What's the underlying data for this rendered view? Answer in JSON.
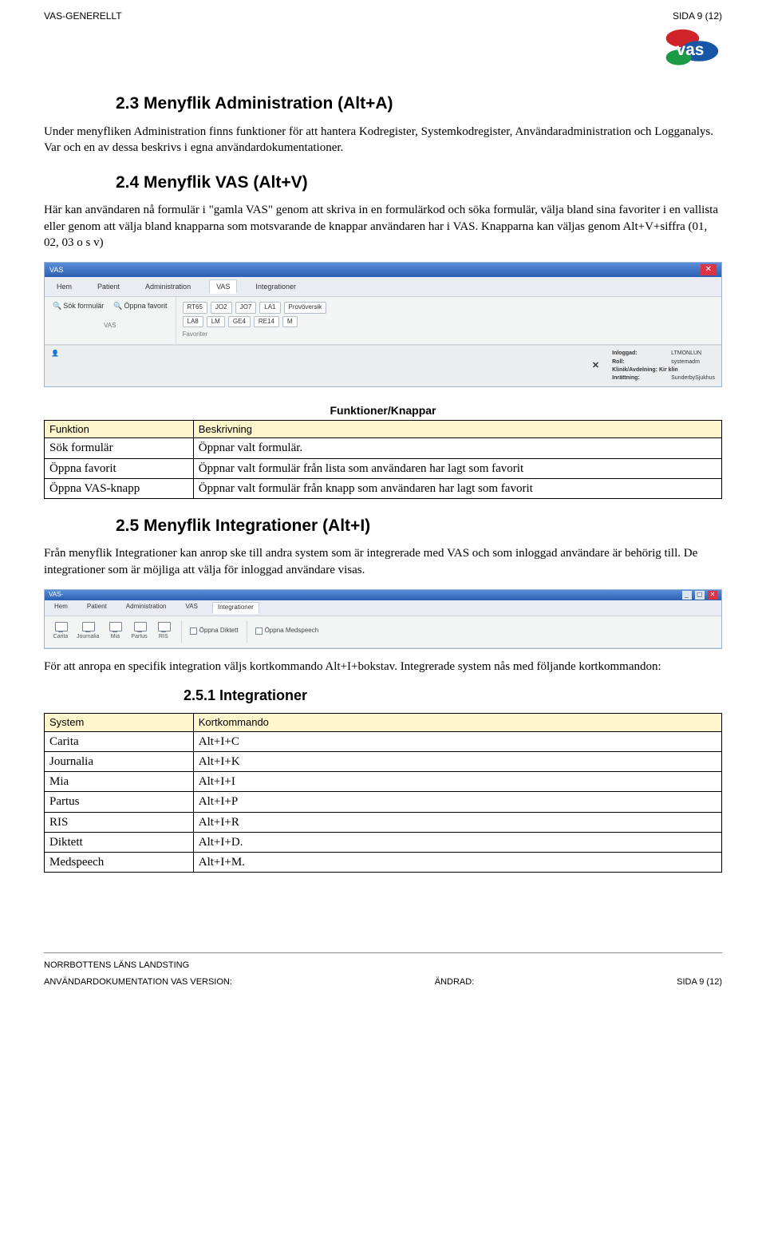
{
  "header": {
    "left": "VAS-GENERELLT",
    "right": "SIDA 9 (12)"
  },
  "logo_title": "VAS",
  "section_23": {
    "title": "2.3 Menyflik Administration (Alt+A)",
    "body": "Under menyfliken Administration finns funktioner för att hantera Kodregister, Systemkodregister, Användaradministration och Logganalys. Var och en av dessa beskrivs i egna användardokumentationer."
  },
  "section_24": {
    "title": "2.4 Menyflik VAS (Alt+V)",
    "body": "Här kan användaren nå formulär i \"gamla VAS\" genom att skriva in en formulärkod och söka formulär, välja bland sina favoriter i en vallista eller genom att välja bland knapparna som motsvarande de knappar användaren har i VAS. Knapparna kan väljas genom Alt+V+siffra (01, 02, 03 o s v)"
  },
  "shot1": {
    "window_title": "VAS",
    "menu": [
      "Hem",
      "Patient",
      "Administration",
      "VAS",
      "Integrationer"
    ],
    "active_menu_index": 3,
    "left_buttons": [
      "Sök formulär",
      "Öppna favorit"
    ],
    "left_group_label": "VAS",
    "fav_rows": [
      [
        "RT65",
        "JO2",
        "JO7",
        "LA1",
        "Provöversik"
      ],
      [
        "LA8",
        "LM",
        "GE4",
        "RE14",
        "M"
      ]
    ],
    "fav_group_label": "Favoriter",
    "status": {
      "inloggad": "LTMONLUN",
      "roll": "systemadm",
      "klinik": "Klinik/Avdelning: Kir klin",
      "inrattning": "SunderbySjukhus",
      "inrattning_label": "Inrättning:"
    }
  },
  "table1_caption": "Funktioner/Knappar",
  "table1": {
    "headers": [
      "Funktion",
      "Beskrivning"
    ],
    "rows": [
      [
        "Sök formulär",
        "Öppnar valt formulär."
      ],
      [
        "Öppna favorit",
        "Öppnar valt formulär från lista som användaren har lagt som favorit"
      ],
      [
        "Öppna VAS-knapp",
        "Öppnar valt formulär från knapp som användaren har lagt som favorit"
      ]
    ]
  },
  "section_25": {
    "title": "2.5 Menyflik Integrationer (Alt+I)",
    "body": "Från menyflik Integrationer kan anrop ske till andra system som är integrerade med VAS och som inloggad användare är behörig till. De integrationer som är möjliga att välja för inloggad användare visas."
  },
  "shot2": {
    "window_title": "VAS-",
    "menu": [
      "Hem",
      "Patient",
      "Administration",
      "VAS",
      "Integrationer"
    ],
    "active_menu_index": 4,
    "integrations": [
      "Carita",
      "Journalia",
      "Mia",
      "Partus",
      "RIS"
    ],
    "checkboxes": [
      "Öppna Diktett",
      "Öppna Medspeech"
    ]
  },
  "section_25_after": "För att anropa en specifik integration väljs kortkommando Alt+I+bokstav. Integrerade system nås med följande kortkommandon:",
  "section_251_title": "2.5.1 Integrationer",
  "table2": {
    "headers": [
      "System",
      "Kortkommando"
    ],
    "rows": [
      [
        "Carita",
        "Alt+I+C"
      ],
      [
        "Journalia",
        "Alt+I+K"
      ],
      [
        "Mia",
        "Alt+I+I"
      ],
      [
        "Partus",
        "Alt+I+P"
      ],
      [
        "RIS",
        "Alt+I+R"
      ],
      [
        "Diktett",
        "Alt+I+D."
      ],
      [
        "Medspeech",
        "Alt+I+M."
      ]
    ]
  },
  "footer": {
    "line1": "NORRBOTTENS LÄNS LANDSTING",
    "line2_left": "ANVÄNDARDOKUMENTATION VAS VERSION:",
    "line2_center": "ÄNDRAD:",
    "line2_right": "SIDA 9 (12)"
  }
}
